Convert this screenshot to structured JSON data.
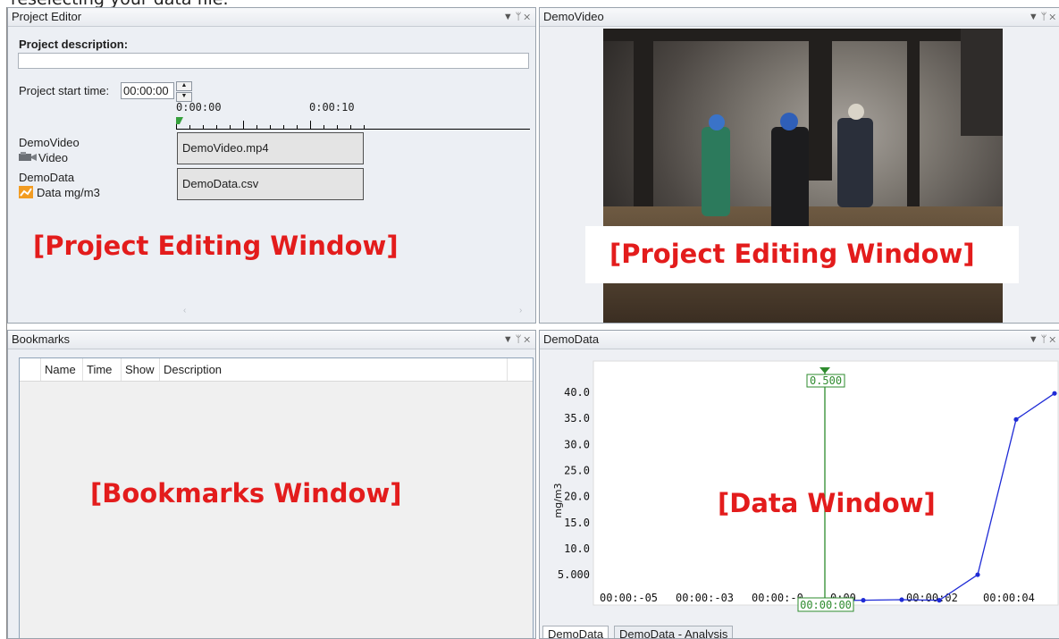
{
  "top_text": "reselecting your data file.",
  "project_editor": {
    "title": "Project Editor",
    "description_label": "Project description:",
    "description_value": "",
    "start_time_label": "Project start time:",
    "start_time_value": "00:00:00",
    "ruler_labels": [
      "0:00:00",
      "0:00:10"
    ],
    "tracks": [
      {
        "name": "DemoVideo",
        "type": "Video",
        "icon": "video-camera-icon",
        "clip": "DemoVideo.mp4"
      },
      {
        "name": "DemoData",
        "type": "Data mg/m3",
        "icon": "data-chart-icon",
        "clip": "DemoData.csv"
      }
    ],
    "overlay_label": "[Project Editing Window]"
  },
  "video_panel": {
    "title": "DemoVideo",
    "overlay_label": "[Project Editing Window]"
  },
  "bookmarks": {
    "title": "Bookmarks",
    "columns": [
      "Name",
      "Time",
      "Show",
      "Description"
    ],
    "overlay_label": "[Bookmarks Window]"
  },
  "data_panel": {
    "title": "DemoData",
    "overlay_label": "[Data Window]",
    "cursor_value": "0.500",
    "cursor_time": "00:00:00",
    "tabs": [
      "DemoData",
      "DemoData - Analysis"
    ]
  },
  "header_icons": [
    "dropdown-icon",
    "pin-icon",
    "close-icon"
  ],
  "chart_data": {
    "type": "line",
    "ylabel": "mg/m3",
    "y_ticks": [
      "40.0",
      "35.0",
      "30.0",
      "25.0",
      "20.0",
      "15.0",
      "10.0",
      "5.000"
    ],
    "x_ticks": [
      "00:00:-05",
      "00:00:-03",
      "00:00:-0",
      "0:00",
      "00:00:02",
      "00:00:04"
    ],
    "x": [
      0,
      0.5,
      1,
      1.5,
      2,
      2.5,
      3
    ],
    "y": [
      0.0,
      0.1,
      0.2,
      0.1,
      5.0,
      34.8,
      39.8
    ],
    "ylim": [
      0,
      42
    ],
    "color": "#1f2bd6"
  }
}
